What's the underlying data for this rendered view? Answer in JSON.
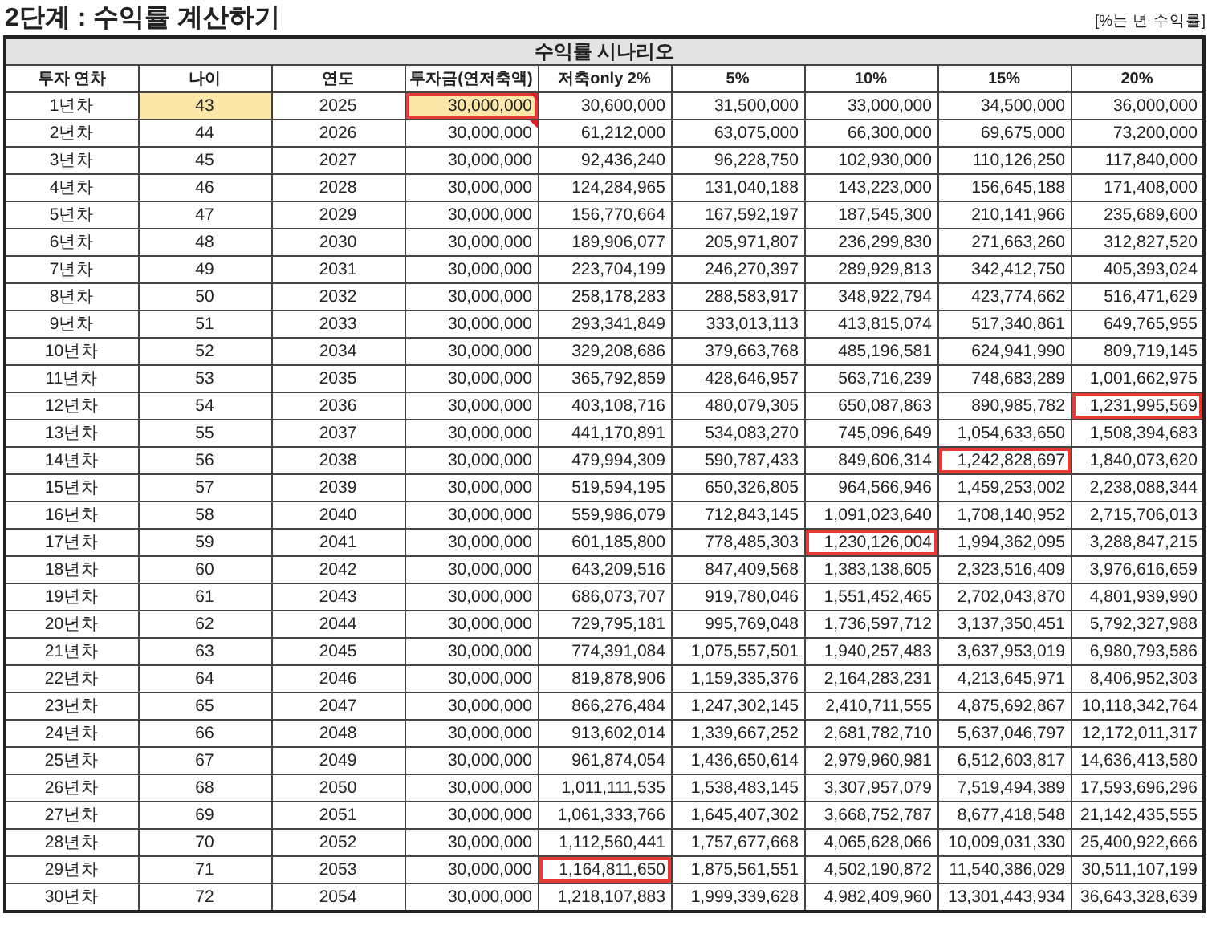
{
  "title": "2단계 : 수익률 계산하기",
  "note": "[%는 년 수익률]",
  "table": {
    "group_header": "수익률 시나리오",
    "columns": [
      "투자 연차",
      "나이",
      "연도",
      "투자금(연저축액)",
      "저축only 2%",
      "5%",
      "10%",
      "15%",
      "20%"
    ],
    "rows": [
      {
        "label": "1년차",
        "age": "43",
        "year": "2025",
        "investment": "30,000,000",
        "values": [
          "30,600,000",
          "31,500,000",
          "33,000,000",
          "34,500,000",
          "36,000,000"
        ],
        "highlighted": true,
        "comment": true,
        "boxed": [
          true,
          false,
          false,
          false,
          false,
          false
        ]
      },
      {
        "label": "2년차",
        "age": "44",
        "year": "2026",
        "investment": "30,000,000",
        "values": [
          "61,212,000",
          "63,075,000",
          "66,300,000",
          "69,675,000",
          "73,200,000"
        ],
        "highlighted": false,
        "comment": true,
        "boxed": [
          false,
          false,
          false,
          false,
          false,
          false
        ]
      },
      {
        "label": "3년차",
        "age": "45",
        "year": "2027",
        "investment": "30,000,000",
        "values": [
          "92,436,240",
          "96,228,750",
          "102,930,000",
          "110,126,250",
          "117,840,000"
        ],
        "highlighted": false,
        "comment": false,
        "boxed": [
          false,
          false,
          false,
          false,
          false,
          false
        ]
      },
      {
        "label": "4년차",
        "age": "46",
        "year": "2028",
        "investment": "30,000,000",
        "values": [
          "124,284,965",
          "131,040,188",
          "143,223,000",
          "156,645,188",
          "171,408,000"
        ],
        "highlighted": false,
        "comment": false,
        "boxed": [
          false,
          false,
          false,
          false,
          false,
          false
        ]
      },
      {
        "label": "5년차",
        "age": "47",
        "year": "2029",
        "investment": "30,000,000",
        "values": [
          "156,770,664",
          "167,592,197",
          "187,545,300",
          "210,141,966",
          "235,689,600"
        ],
        "highlighted": false,
        "comment": false,
        "boxed": [
          false,
          false,
          false,
          false,
          false,
          false
        ]
      },
      {
        "label": "6년차",
        "age": "48",
        "year": "2030",
        "investment": "30,000,000",
        "values": [
          "189,906,077",
          "205,971,807",
          "236,299,830",
          "271,663,260",
          "312,827,520"
        ],
        "highlighted": false,
        "comment": false,
        "boxed": [
          false,
          false,
          false,
          false,
          false,
          false
        ]
      },
      {
        "label": "7년차",
        "age": "49",
        "year": "2031",
        "investment": "30,000,000",
        "values": [
          "223,704,199",
          "246,270,397",
          "289,929,813",
          "342,412,750",
          "405,393,024"
        ],
        "highlighted": false,
        "comment": false,
        "boxed": [
          false,
          false,
          false,
          false,
          false,
          false
        ]
      },
      {
        "label": "8년차",
        "age": "50",
        "year": "2032",
        "investment": "30,000,000",
        "values": [
          "258,178,283",
          "288,583,917",
          "348,922,794",
          "423,774,662",
          "516,471,629"
        ],
        "highlighted": false,
        "comment": false,
        "boxed": [
          false,
          false,
          false,
          false,
          false,
          false
        ]
      },
      {
        "label": "9년차",
        "age": "51",
        "year": "2033",
        "investment": "30,000,000",
        "values": [
          "293,341,849",
          "333,013,113",
          "413,815,074",
          "517,340,861",
          "649,765,955"
        ],
        "highlighted": false,
        "comment": false,
        "boxed": [
          false,
          false,
          false,
          false,
          false,
          false
        ]
      },
      {
        "label": "10년차",
        "age": "52",
        "year": "2034",
        "investment": "30,000,000",
        "values": [
          "329,208,686",
          "379,663,768",
          "485,196,581",
          "624,941,990",
          "809,719,145"
        ],
        "highlighted": false,
        "comment": false,
        "boxed": [
          false,
          false,
          false,
          false,
          false,
          false
        ]
      },
      {
        "label": "11년차",
        "age": "53",
        "year": "2035",
        "investment": "30,000,000",
        "values": [
          "365,792,859",
          "428,646,957",
          "563,716,239",
          "748,683,289",
          "1,001,662,975"
        ],
        "highlighted": false,
        "comment": false,
        "boxed": [
          false,
          false,
          false,
          false,
          false,
          false
        ]
      },
      {
        "label": "12년차",
        "age": "54",
        "year": "2036",
        "investment": "30,000,000",
        "values": [
          "403,108,716",
          "480,079,305",
          "650,087,863",
          "890,985,782",
          "1,231,995,569"
        ],
        "highlighted": false,
        "comment": false,
        "boxed": [
          false,
          false,
          false,
          false,
          false,
          true
        ]
      },
      {
        "label": "13년차",
        "age": "55",
        "year": "2037",
        "investment": "30,000,000",
        "values": [
          "441,170,891",
          "534,083,270",
          "745,096,649",
          "1,054,633,650",
          "1,508,394,683"
        ],
        "highlighted": false,
        "comment": false,
        "boxed": [
          false,
          false,
          false,
          false,
          false,
          false
        ]
      },
      {
        "label": "14년차",
        "age": "56",
        "year": "2038",
        "investment": "30,000,000",
        "values": [
          "479,994,309",
          "590,787,433",
          "849,606,314",
          "1,242,828,697",
          "1,840,073,620"
        ],
        "highlighted": false,
        "comment": false,
        "boxed": [
          false,
          false,
          false,
          false,
          true,
          false
        ]
      },
      {
        "label": "15년차",
        "age": "57",
        "year": "2039",
        "investment": "30,000,000",
        "values": [
          "519,594,195",
          "650,326,805",
          "964,566,946",
          "1,459,253,002",
          "2,238,088,344"
        ],
        "highlighted": false,
        "comment": false,
        "boxed": [
          false,
          false,
          false,
          false,
          false,
          false
        ]
      },
      {
        "label": "16년차",
        "age": "58",
        "year": "2040",
        "investment": "30,000,000",
        "values": [
          "559,986,079",
          "712,843,145",
          "1,091,023,640",
          "1,708,140,952",
          "2,715,706,013"
        ],
        "highlighted": false,
        "comment": false,
        "boxed": [
          false,
          false,
          false,
          false,
          false,
          false
        ]
      },
      {
        "label": "17년차",
        "age": "59",
        "year": "2041",
        "investment": "30,000,000",
        "values": [
          "601,185,800",
          "778,485,303",
          "1,230,126,004",
          "1,994,362,095",
          "3,288,847,215"
        ],
        "highlighted": false,
        "comment": false,
        "boxed": [
          false,
          false,
          false,
          true,
          false,
          false
        ]
      },
      {
        "label": "18년차",
        "age": "60",
        "year": "2042",
        "investment": "30,000,000",
        "values": [
          "643,209,516",
          "847,409,568",
          "1,383,138,605",
          "2,323,516,409",
          "3,976,616,659"
        ],
        "highlighted": false,
        "comment": false,
        "boxed": [
          false,
          false,
          false,
          false,
          false,
          false
        ]
      },
      {
        "label": "19년차",
        "age": "61",
        "year": "2043",
        "investment": "30,000,000",
        "values": [
          "686,073,707",
          "919,780,046",
          "1,551,452,465",
          "2,702,043,870",
          "4,801,939,990"
        ],
        "highlighted": false,
        "comment": false,
        "boxed": [
          false,
          false,
          false,
          false,
          false,
          false
        ]
      },
      {
        "label": "20년차",
        "age": "62",
        "year": "2044",
        "investment": "30,000,000",
        "values": [
          "729,795,181",
          "995,769,048",
          "1,736,597,712",
          "3,137,350,451",
          "5,792,327,988"
        ],
        "highlighted": false,
        "comment": false,
        "boxed": [
          false,
          false,
          false,
          false,
          false,
          false
        ]
      },
      {
        "label": "21년차",
        "age": "63",
        "year": "2045",
        "investment": "30,000,000",
        "values": [
          "774,391,084",
          "1,075,557,501",
          "1,940,257,483",
          "3,637,953,019",
          "6,980,793,586"
        ],
        "highlighted": false,
        "comment": false,
        "boxed": [
          false,
          false,
          false,
          false,
          false,
          false
        ]
      },
      {
        "label": "22년차",
        "age": "64",
        "year": "2046",
        "investment": "30,000,000",
        "values": [
          "819,878,906",
          "1,159,335,376",
          "2,164,283,231",
          "4,213,645,971",
          "8,406,952,303"
        ],
        "highlighted": false,
        "comment": false,
        "boxed": [
          false,
          false,
          false,
          false,
          false,
          false
        ]
      },
      {
        "label": "23년차",
        "age": "65",
        "year": "2047",
        "investment": "30,000,000",
        "values": [
          "866,276,484",
          "1,247,302,145",
          "2,410,711,555",
          "4,875,692,867",
          "10,118,342,764"
        ],
        "highlighted": false,
        "comment": false,
        "boxed": [
          false,
          false,
          false,
          false,
          false,
          false
        ]
      },
      {
        "label": "24년차",
        "age": "66",
        "year": "2048",
        "investment": "30,000,000",
        "values": [
          "913,602,014",
          "1,339,667,252",
          "2,681,782,710",
          "5,637,046,797",
          "12,172,011,317"
        ],
        "highlighted": false,
        "comment": false,
        "boxed": [
          false,
          false,
          false,
          false,
          false,
          false
        ]
      },
      {
        "label": "25년차",
        "age": "67",
        "year": "2049",
        "investment": "30,000,000",
        "values": [
          "961,874,054",
          "1,436,650,614",
          "2,979,960,981",
          "6,512,603,817",
          "14,636,413,580"
        ],
        "highlighted": false,
        "comment": false,
        "boxed": [
          false,
          false,
          false,
          false,
          false,
          false
        ]
      },
      {
        "label": "26년차",
        "age": "68",
        "year": "2050",
        "investment": "30,000,000",
        "values": [
          "1,011,111,535",
          "1,538,483,145",
          "3,307,957,079",
          "7,519,494,389",
          "17,593,696,296"
        ],
        "highlighted": false,
        "comment": false,
        "boxed": [
          false,
          false,
          false,
          false,
          false,
          false
        ]
      },
      {
        "label": "27년차",
        "age": "69",
        "year": "2051",
        "investment": "30,000,000",
        "values": [
          "1,061,333,766",
          "1,645,407,302",
          "3,668,752,787",
          "8,677,418,548",
          "21,142,435,555"
        ],
        "highlighted": false,
        "comment": false,
        "boxed": [
          false,
          false,
          false,
          false,
          false,
          false
        ]
      },
      {
        "label": "28년차",
        "age": "70",
        "year": "2052",
        "investment": "30,000,000",
        "values": [
          "1,112,560,441",
          "1,757,677,668",
          "4,065,628,066",
          "10,009,031,330",
          "25,400,922,666"
        ],
        "highlighted": false,
        "comment": false,
        "boxed": [
          false,
          false,
          false,
          false,
          false,
          false
        ]
      },
      {
        "label": "29년차",
        "age": "71",
        "year": "2053",
        "investment": "30,000,000",
        "values": [
          "1,164,811,650",
          "1,875,561,551",
          "4,502,190,872",
          "11,540,386,029",
          "30,511,107,199"
        ],
        "highlighted": false,
        "comment": false,
        "boxed": [
          false,
          true,
          false,
          false,
          false,
          false
        ]
      },
      {
        "label": "30년차",
        "age": "72",
        "year": "2054",
        "investment": "30,000,000",
        "values": [
          "1,218,107,883",
          "1,999,339,628",
          "4,982,409,960",
          "13,301,443,934",
          "36,643,328,639"
        ],
        "highlighted": false,
        "comment": false,
        "boxed": [
          false,
          false,
          false,
          false,
          false,
          false
        ]
      }
    ]
  }
}
